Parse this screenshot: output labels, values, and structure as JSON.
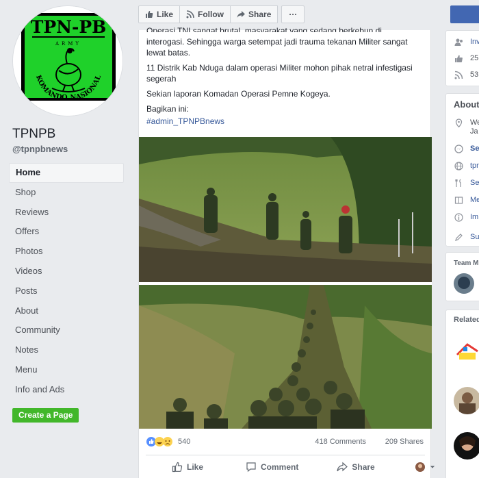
{
  "sidebar": {
    "page_name": "TPNPB",
    "handle": "@tpnpbnews",
    "logo_top_text": "TPN-PB",
    "logo_army": "ARMY",
    "logo_arc_text": "KOMANDO NASIONAL",
    "nav": [
      "Home",
      "Shop",
      "Reviews",
      "Offers",
      "Photos",
      "Videos",
      "Posts",
      "About",
      "Community",
      "Notes",
      "Menu",
      "Info and Ads"
    ],
    "create_page": "Create a Page"
  },
  "action_bar": {
    "like": "Like",
    "follow": "Follow",
    "share": "Share",
    "more": "···"
  },
  "post": {
    "line_partial": "Operasi TNI sangat brutal, masyarakat yang sedang berkebun di",
    "line_1": "interogasi. Sehingga warga setempat jadi trauma tekanan Militer sangat lewat batas.",
    "line_2": "11 Distrik Kab Nduga dalam operasi Militer mohon pihak netral infestigasi segerah",
    "line_3": "Sekian laporan Komadan Operasi Pemne Kogeya.",
    "line_4": "Bagikan ini:",
    "hashtag": "#admin_TPNPBnews",
    "reaction_count": "540",
    "comments": "418 Comments",
    "shares": "209 Shares",
    "action_like": "Like",
    "action_comment": "Comment",
    "action_share": "Share"
  },
  "right_column": {
    "card1": [
      "Inv",
      "25",
      "53"
    ],
    "about_title": "About",
    "about_rows": [
      "We",
      "Ja",
      "Se",
      "tpn",
      "Se",
      "Me",
      "Im",
      "Su"
    ],
    "team_title": "Team M",
    "related_title": "Related"
  },
  "colors": {
    "brand_blue": "#4267b2",
    "link": "#365899",
    "create_green": "#42b72a",
    "logo_green": "#1fd12a"
  }
}
